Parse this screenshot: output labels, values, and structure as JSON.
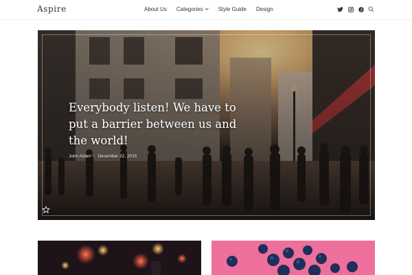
{
  "header": {
    "logo": "Aspire",
    "nav": [
      {
        "label": "About Us"
      },
      {
        "label": "Categories",
        "has_dropdown": true
      },
      {
        "label": "Style Guide"
      },
      {
        "label": "Design"
      }
    ],
    "social_icons": [
      "twitter-icon",
      "instagram-icon",
      "pinterest-icon",
      "search-icon"
    ]
  },
  "hero": {
    "title": "Everybody listen! We have to put a barrier between us and the world!",
    "author": "John Adam",
    "separator": "-",
    "date": "December 22, 2015",
    "badge_icon": "star-icon"
  },
  "cards": [
    {
      "image": "city-lights-night-photo"
    },
    {
      "image": "blueberries-on-pink-photo"
    }
  ],
  "colors": {
    "text": "#333333",
    "hero_overlay": "#2b2420",
    "card_pink": "#ee6f9b"
  }
}
